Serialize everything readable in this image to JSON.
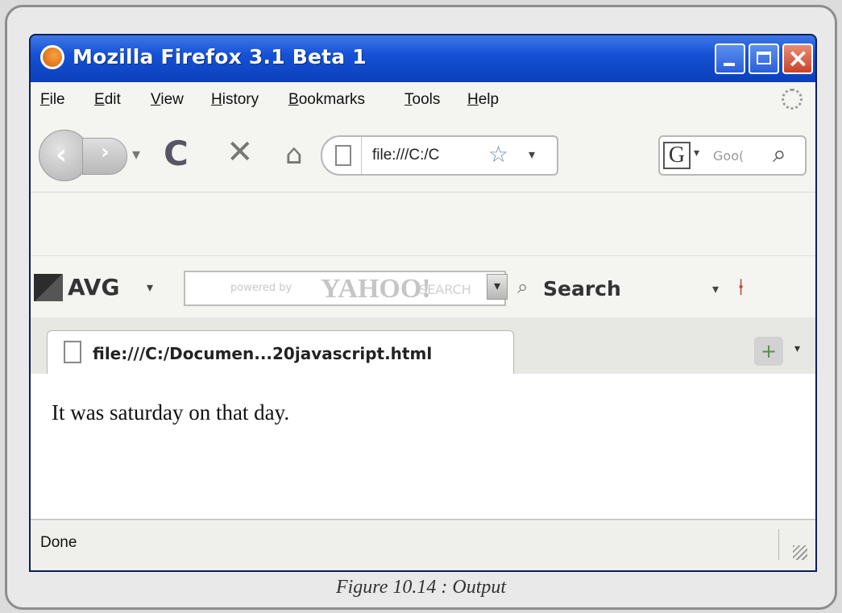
{
  "window": {
    "title": "Mozilla Firefox 3.1 Beta 1",
    "controls": [
      "minimize",
      "maximize",
      "close"
    ]
  },
  "menubar": {
    "items": [
      "File",
      "Edit",
      "View",
      "History",
      "Bookmarks",
      "Tools",
      "Help"
    ]
  },
  "navigation": {
    "url": "file:///C:/C",
    "search_placeholder": "Goo(",
    "search_engine_letter": "G"
  },
  "avg_toolbar": {
    "brand": "AVG",
    "powered_by": "powered by",
    "provider": "YAHOO!",
    "search_hint": "SEARCH",
    "search_button": "Search"
  },
  "tabs": [
    {
      "title": "file:///C:/Documen...20javascript.html"
    }
  ],
  "content": {
    "body_text": "It was saturday on that day."
  },
  "status": {
    "text": "Done"
  },
  "figure_caption": "Figure 10.14 : Output",
  "icons": {
    "app": "firefox-icon",
    "back": "back-arrow-icon",
    "forward": "forward-arrow-icon",
    "reload": "reload-icon",
    "stop": "stop-icon",
    "home": "home-icon",
    "page": "page-icon",
    "bookmark": "star-icon",
    "search": "magnifier-icon",
    "new_tab": "plus-icon"
  }
}
